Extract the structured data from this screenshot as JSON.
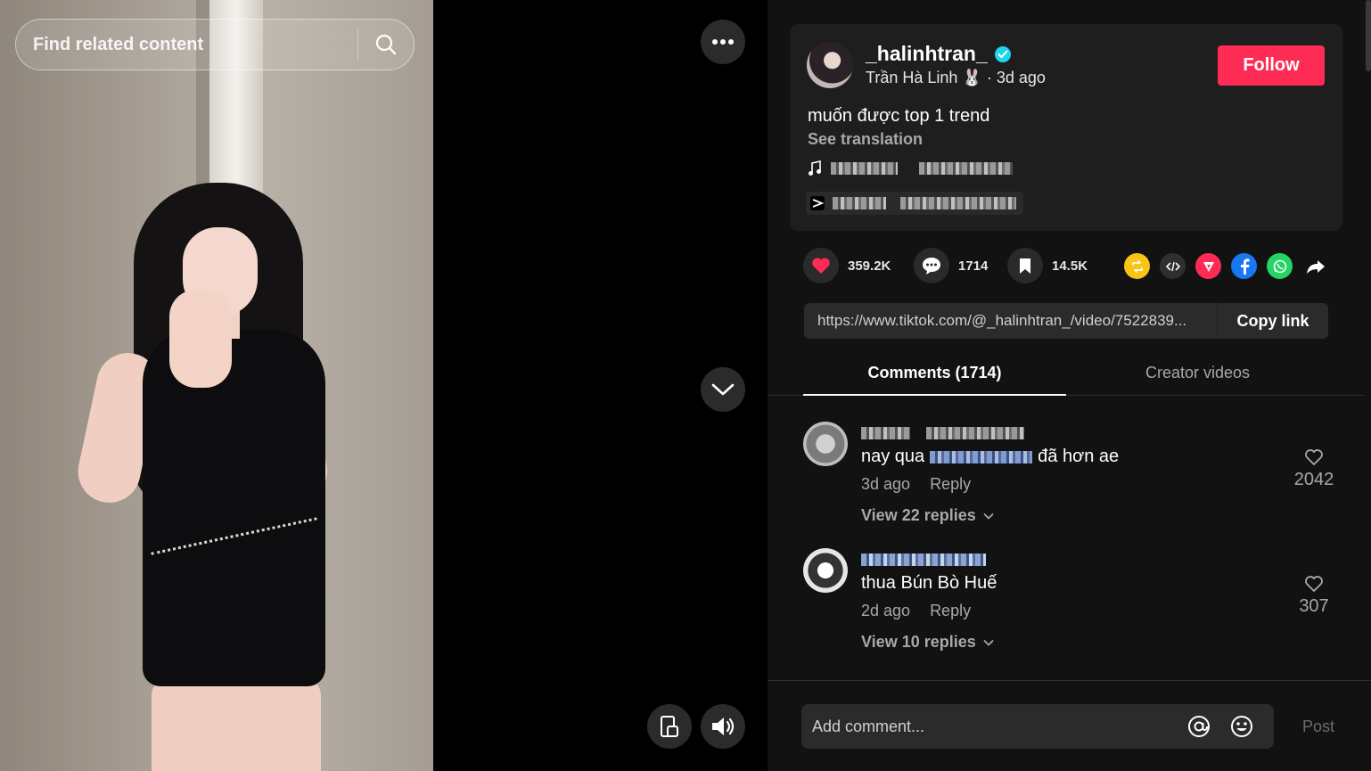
{
  "search": {
    "placeholder": "Find related content"
  },
  "author": {
    "username": "_halinhtran_",
    "display_name": "Trần Hà Linh 🐰",
    "time": "· 3d ago",
    "follow_label": "Follow"
  },
  "post": {
    "caption": "muốn được top 1 trend",
    "see_translation": "See translation"
  },
  "stats": {
    "likes": "359.2K",
    "comments": "1714",
    "saves": "14.5K"
  },
  "share": {
    "url": "https://www.tiktok.com/@_halinhtran_/video/7522839...",
    "copy_label": "Copy link",
    "icons": [
      "repost-icon",
      "embed-icon",
      "send-icon",
      "facebook-icon",
      "whatsapp-icon",
      "share-arrow-icon"
    ]
  },
  "tabs": [
    {
      "label": "Comments (1714)"
    },
    {
      "label": "Creator videos"
    }
  ],
  "comments": [
    {
      "text_before": "nay qua",
      "text_after": "đã hơn ae",
      "time": "3d ago",
      "reply": "Reply",
      "replies": "View 22 replies",
      "likes": "2042"
    },
    {
      "text_before": "thua Bún Bò Huế",
      "text_after": "",
      "time": "2d ago",
      "reply": "Reply",
      "replies": "View 10 replies",
      "likes": "307"
    }
  ],
  "composer": {
    "placeholder": "Add comment...",
    "post_label": "Post"
  },
  "colors": {
    "accent": "#fe2c55",
    "verified": "#20d5ec",
    "background": "#121212"
  }
}
